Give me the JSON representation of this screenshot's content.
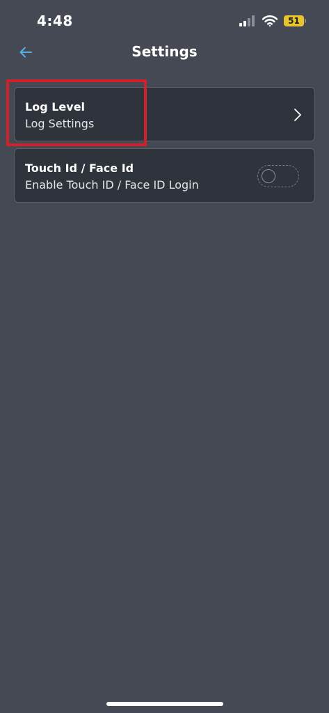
{
  "status_bar": {
    "time": "4:48",
    "battery_level": "51",
    "signal_bars_active": 2,
    "signal_bars_total": 4,
    "battery_color": "#e6c52e"
  },
  "header": {
    "title": "Settings",
    "back_icon": "arrow-left-icon",
    "back_icon_color": "#5aaee8"
  },
  "settings": {
    "log_level": {
      "title": "Log Level",
      "subtitle": "Log Settings",
      "icon": "chevron-right-icon"
    },
    "touch_id": {
      "title": "Touch Id / Face Id",
      "subtitle": "Enable Touch ID / Face ID Login",
      "enabled": false
    }
  },
  "annotation": {
    "highlight_color": "#d0202a"
  }
}
